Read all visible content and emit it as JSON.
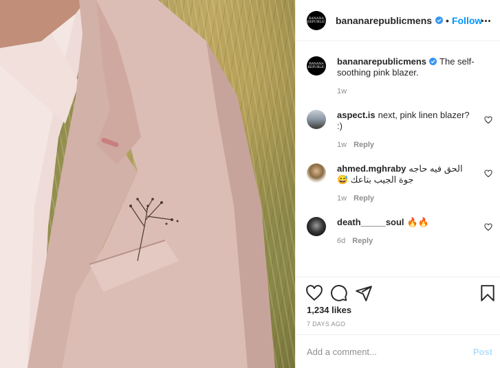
{
  "post": {
    "image_alt": "Man wearing a pink blazer with a dried flower in the pocket",
    "account": {
      "avatar_text": "BANANA REPUBLIC",
      "username": "bananarepublicmens",
      "separator": "•",
      "follow_label": "Follow"
    },
    "caption": {
      "username": "bananarepublicmens",
      "text": "The self-soothing pink blazer.",
      "time": "1w"
    },
    "comments": [
      {
        "username": "aspect.is",
        "text": "next, pink linen blazer? :)",
        "time": "1w",
        "reply_label": "Reply"
      },
      {
        "username": "ahmed.mghraby",
        "text": "الحق فيه حاجه جوة الجيب بتاعك 😅",
        "time": "1w",
        "reply_label": "Reply"
      },
      {
        "username": "death_____soul",
        "text": "🔥🔥",
        "time": "6d",
        "reply_label": "Reply"
      }
    ],
    "likes": "1,234 likes",
    "date": "7 DAYS AGO",
    "add_comment": {
      "placeholder": "Add a comment...",
      "post_label": "Post"
    }
  },
  "colors": {
    "link": "#0095f6",
    "post_disabled": "#b2dffc",
    "muted": "#8e8e8e",
    "text": "#262626",
    "blazer": "#d8bab2"
  },
  "icons": [
    "verified-badge-icon",
    "more-options-icon",
    "heart-icon",
    "comment-icon",
    "share-icon",
    "save-icon"
  ]
}
